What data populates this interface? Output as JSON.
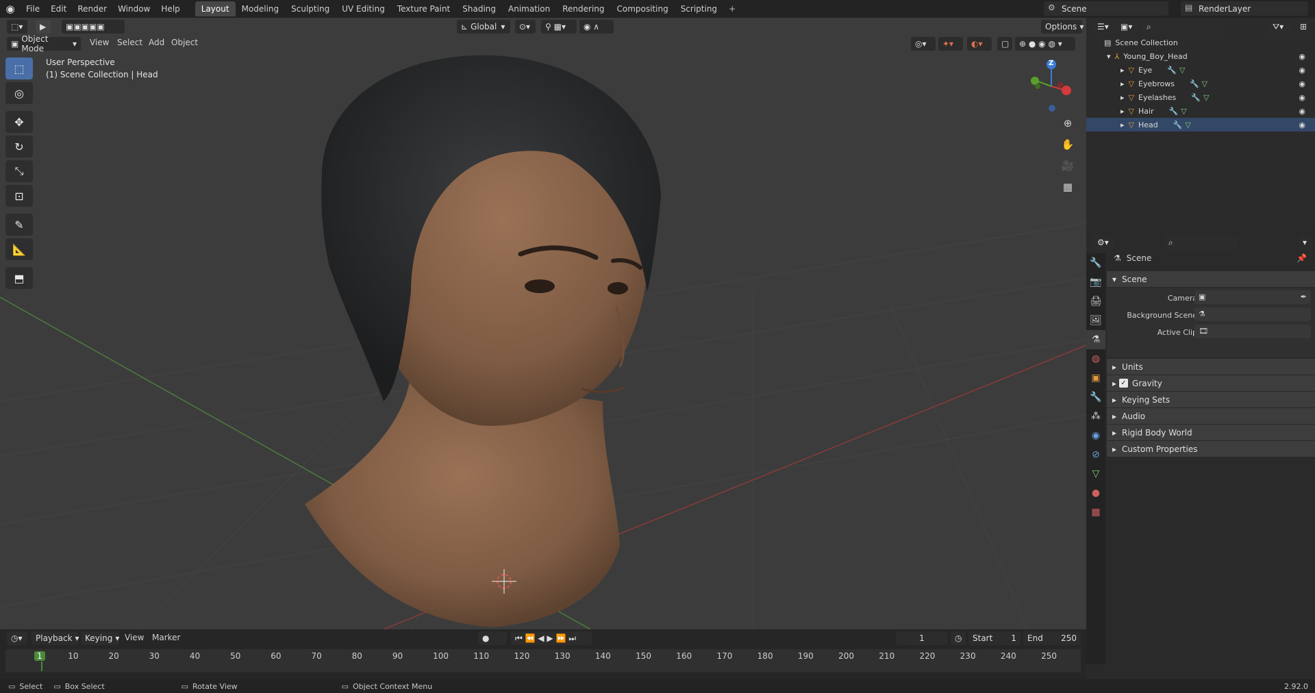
{
  "menu": [
    "File",
    "Edit",
    "Render",
    "Window",
    "Help"
  ],
  "workspaces": [
    "Layout",
    "Modeling",
    "Sculpting",
    "UV Editing",
    "Texture Paint",
    "Shading",
    "Animation",
    "Rendering",
    "Compositing",
    "Scripting"
  ],
  "active_workspace": "Layout",
  "add_tab": "+",
  "scene_name": "Scene",
  "view_layer": "RenderLayer",
  "viewport": {
    "mode": "Object Mode",
    "menus": [
      "View",
      "Select",
      "Add",
      "Object"
    ],
    "transform_orientation": "Global",
    "options": "Options",
    "perspective": "User Perspective",
    "collection_info": "(1) Scene Collection | Head",
    "gizmo_axis": "Z"
  },
  "outliner": {
    "root": "Scene Collection",
    "collection": "Young_Boy_Head",
    "objects": [
      "Eye",
      "Eyebrows",
      "Eyelashes",
      "Hair",
      "Head"
    ]
  },
  "properties": {
    "context": "Scene",
    "panel": "Scene",
    "fields": [
      "Camera",
      "Background Scene",
      "Active Clip"
    ],
    "subpanels": [
      "Units",
      "Gravity",
      "Keying Sets",
      "Audio",
      "Rigid Body World",
      "Custom Properties"
    ]
  },
  "timeline": {
    "menus": [
      "Playback",
      "Keying",
      "View",
      "Marker"
    ],
    "current_frame": "1",
    "start_label": "Start",
    "start": "1",
    "end_label": "End",
    "end": "250",
    "ticks": [
      "1",
      "10",
      "20",
      "30",
      "40",
      "50",
      "60",
      "70",
      "80",
      "90",
      "100",
      "110",
      "120",
      "130",
      "140",
      "150",
      "160",
      "170",
      "180",
      "190",
      "200",
      "210",
      "220",
      "230",
      "240",
      "250"
    ]
  },
  "status": {
    "select": "Select",
    "box_select": "Box Select",
    "rotate": "Rotate View",
    "context_menu": "Object Context Menu",
    "version": "2.92.0"
  }
}
